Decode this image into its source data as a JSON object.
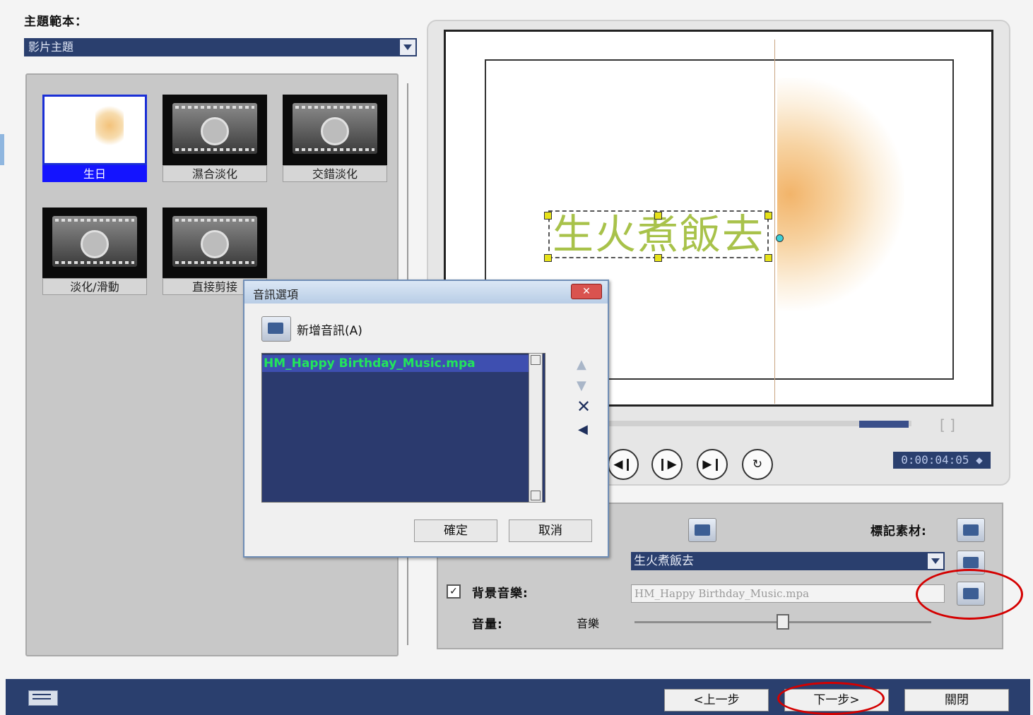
{
  "left": {
    "theme_label": "主題範本：",
    "theme_selected": "影片主題",
    "thumbnails": [
      {
        "label": "生日",
        "selected": true
      },
      {
        "label": "濕合淡化"
      },
      {
        "label": "交錯淡化"
      },
      {
        "label": "淡化/滑動"
      },
      {
        "label": "直接剪接"
      }
    ]
  },
  "preview": {
    "title_text": "生火煮飯去",
    "timecode": "0:00:04:05"
  },
  "options": {
    "mark_clip_label": "標記素材:",
    "title_value": "生火煮飯去",
    "bg_music_label": "背景音樂:",
    "bg_music_value": "HM_Happy Birthday_Music.mpa",
    "volume_label": "音量:",
    "volume_sub_label": "音樂",
    "volume_level": 0.5
  },
  "dialog": {
    "title": "音訊選項",
    "add_audio": "新增音訊(A)",
    "items": [
      "HM_Happy Birthday_Music.mpa"
    ],
    "ok": "確定",
    "cancel": "取消"
  },
  "nav": {
    "prev": "<上一步",
    "next": "下一步>",
    "close": "關閉"
  },
  "colors": {
    "accent": "#2a3f6e",
    "highlight": "#d40000",
    "selected_item_text": "#22e55b"
  }
}
